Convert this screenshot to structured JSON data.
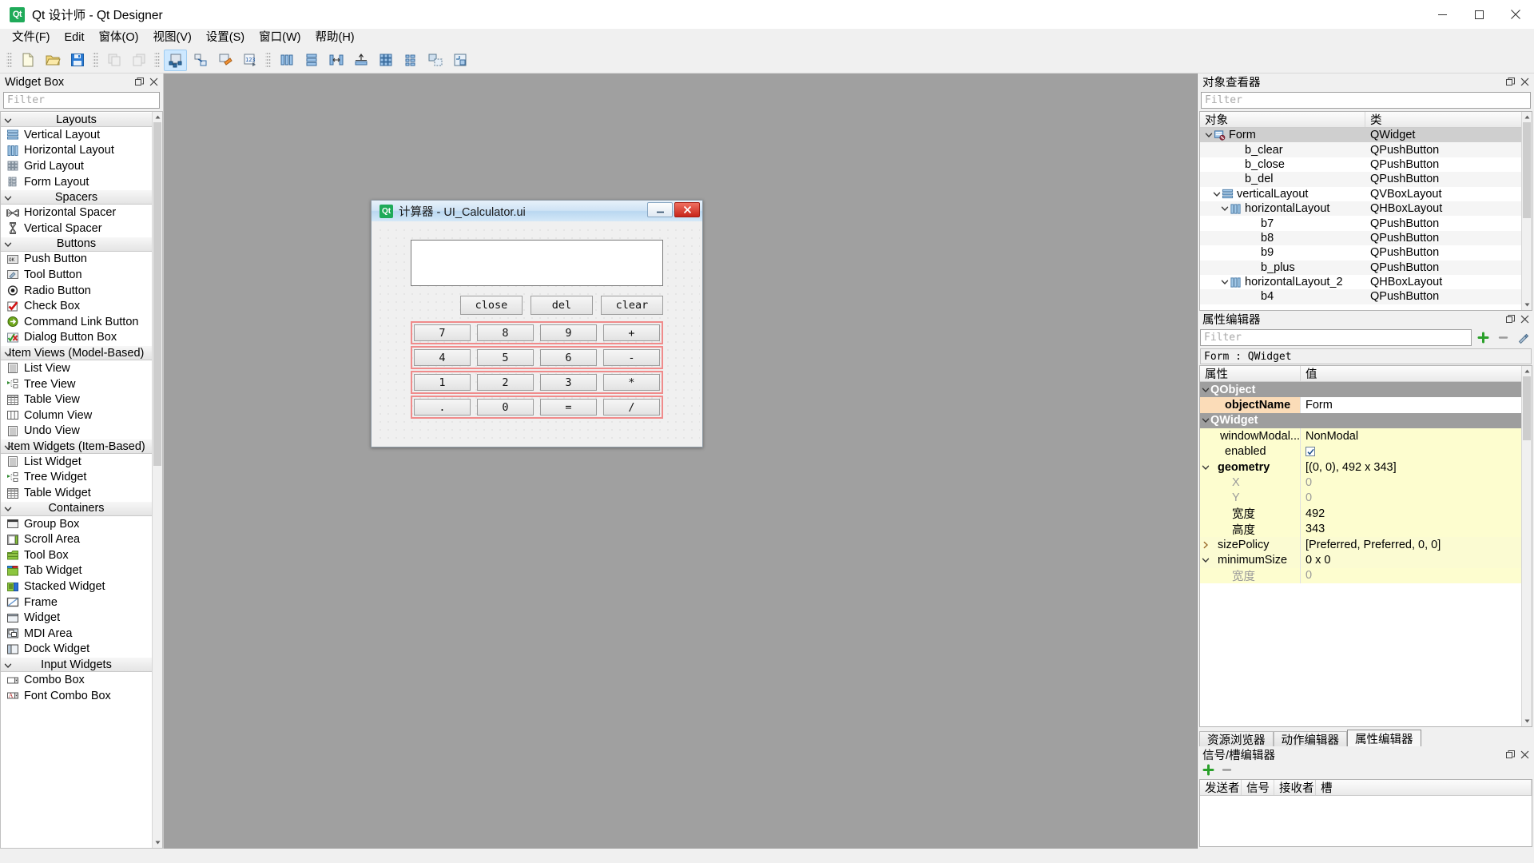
{
  "window": {
    "title": "Qt 设计师 - Qt Designer",
    "icon": "Qt",
    "minimize": "minimize-icon",
    "maximize": "maximize-icon",
    "close": "close-icon"
  },
  "menubar": {
    "items": [
      {
        "label": "文件(F)"
      },
      {
        "label": "Edit"
      },
      {
        "label": "窗体(O)"
      },
      {
        "label": "视图(V)"
      },
      {
        "label": "设置(S)"
      },
      {
        "label": "窗口(W)"
      },
      {
        "label": "帮助(H)"
      }
    ]
  },
  "toolbar": {
    "groups": [
      {
        "buttons": [
          {
            "name": "new-form-icon",
            "state": "enabled"
          },
          {
            "name": "open-form-icon",
            "state": "enabled"
          },
          {
            "name": "save-form-icon",
            "state": "enabled"
          }
        ]
      },
      {
        "buttons": [
          {
            "name": "undo-icon",
            "state": "disabled"
          },
          {
            "name": "redo-icon",
            "state": "disabled"
          }
        ]
      },
      {
        "buttons": [
          {
            "name": "edit-widgets-icon",
            "state": "active"
          },
          {
            "name": "edit-signals-slots-icon",
            "state": "enabled"
          },
          {
            "name": "edit-buddies-icon",
            "state": "enabled"
          },
          {
            "name": "edit-tab-order-icon",
            "state": "enabled"
          }
        ]
      },
      {
        "buttons": [
          {
            "name": "layout-horizontally-icon",
            "state": "enabled"
          },
          {
            "name": "layout-vertically-icon",
            "state": "enabled"
          },
          {
            "name": "layout-splitter-horizontal-icon",
            "state": "enabled"
          },
          {
            "name": "layout-splitter-vertical-icon",
            "state": "enabled"
          },
          {
            "name": "layout-grid-icon",
            "state": "enabled"
          },
          {
            "name": "layout-form-icon",
            "state": "enabled"
          },
          {
            "name": "break-layout-icon",
            "state": "enabled"
          },
          {
            "name": "adjust-size-icon",
            "state": "enabled"
          }
        ]
      }
    ]
  },
  "widget_box": {
    "title": "Widget Box",
    "float_icon": "float-icon",
    "close_icon": "close-icon",
    "filter_placeholder": "Filter",
    "groups": [
      {
        "label": "Layouts",
        "items": [
          {
            "label": "Vertical Layout",
            "icon": "vertical-layout-icon"
          },
          {
            "label": "Horizontal Layout",
            "icon": "horizontal-layout-icon"
          },
          {
            "label": "Grid Layout",
            "icon": "grid-layout-icon"
          },
          {
            "label": "Form Layout",
            "icon": "form-layout-icon"
          }
        ]
      },
      {
        "label": "Spacers",
        "items": [
          {
            "label": "Horizontal Spacer",
            "icon": "horizontal-spacer-icon"
          },
          {
            "label": "Vertical Spacer",
            "icon": "vertical-spacer-icon"
          }
        ]
      },
      {
        "label": "Buttons",
        "items": [
          {
            "label": "Push Button",
            "icon": "push-button-icon"
          },
          {
            "label": "Tool Button",
            "icon": "tool-button-icon"
          },
          {
            "label": "Radio Button",
            "icon": "radio-button-icon"
          },
          {
            "label": "Check Box",
            "icon": "check-box-icon"
          },
          {
            "label": "Command Link Button",
            "icon": "command-link-icon"
          },
          {
            "label": "Dialog Button Box",
            "icon": "dialog-button-box-icon"
          }
        ]
      },
      {
        "label": "Item Views (Model-Based)",
        "items": [
          {
            "label": "List View",
            "icon": "list-view-icon"
          },
          {
            "label": "Tree View",
            "icon": "tree-view-icon"
          },
          {
            "label": "Table View",
            "icon": "table-view-icon"
          },
          {
            "label": "Column View",
            "icon": "column-view-icon"
          },
          {
            "label": "Undo View",
            "icon": "undo-view-icon"
          }
        ]
      },
      {
        "label": "Item Widgets (Item-Based)",
        "items": [
          {
            "label": "List Widget",
            "icon": "list-widget-icon"
          },
          {
            "label": "Tree Widget",
            "icon": "tree-widget-icon"
          },
          {
            "label": "Table Widget",
            "icon": "table-widget-icon"
          }
        ]
      },
      {
        "label": "Containers",
        "items": [
          {
            "label": "Group Box",
            "icon": "group-box-icon"
          },
          {
            "label": "Scroll Area",
            "icon": "scroll-area-icon"
          },
          {
            "label": "Tool Box",
            "icon": "tool-box-icon"
          },
          {
            "label": "Tab Widget",
            "icon": "tab-widget-icon"
          },
          {
            "label": "Stacked Widget",
            "icon": "stacked-widget-icon"
          },
          {
            "label": "Frame",
            "icon": "frame-icon"
          },
          {
            "label": "Widget",
            "icon": "widget-icon"
          },
          {
            "label": "MDI Area",
            "icon": "mdi-area-icon"
          },
          {
            "label": "Dock Widget",
            "icon": "dock-widget-icon"
          }
        ]
      },
      {
        "label": "Input Widgets",
        "items": [
          {
            "label": "Combo Box",
            "icon": "combo-box-icon"
          },
          {
            "label": "Font Combo Box",
            "icon": "font-combo-box-icon"
          }
        ]
      }
    ]
  },
  "form": {
    "title": "计算器 - UI_Calculator.ui",
    "icon": "Qt",
    "minimize": "minimize-icon",
    "close": "close-icon",
    "display_value": "",
    "top_buttons": [
      {
        "label": "close",
        "name": "b_close"
      },
      {
        "label": "del",
        "name": "b_del"
      },
      {
        "label": "clear",
        "name": "b_clear"
      }
    ],
    "keypad": [
      [
        "7",
        "8",
        "9",
        "+"
      ],
      [
        "4",
        "5",
        "6",
        "-"
      ],
      [
        "1",
        "2",
        "3",
        "*"
      ],
      [
        ".",
        "0",
        "=",
        "/"
      ]
    ]
  },
  "object_inspector": {
    "title": "对象查看器",
    "float_icon": "float-icon",
    "close_icon": "close-icon",
    "filter_placeholder": "Filter",
    "columns": {
      "name": "对象",
      "class": "类"
    },
    "rows": [
      {
        "name": "Form",
        "class": "QWidget",
        "depth": 0,
        "expander": "down",
        "icon": "form-icon",
        "selected": true
      },
      {
        "name": "b_clear",
        "class": "QPushButton",
        "depth": 2,
        "expander": "",
        "icon": ""
      },
      {
        "name": "b_close",
        "class": "QPushButton",
        "depth": 2,
        "expander": "",
        "icon": ""
      },
      {
        "name": "b_del",
        "class": "QPushButton",
        "depth": 2,
        "expander": "",
        "icon": ""
      },
      {
        "name": "verticalLayout",
        "class": "QVBoxLayout",
        "depth": 1,
        "expander": "down",
        "icon": "vertical-layout-icon"
      },
      {
        "name": "horizontalLayout",
        "class": "QHBoxLayout",
        "depth": 2,
        "expander": "down",
        "icon": "horizontal-layout-icon"
      },
      {
        "name": "b7",
        "class": "QPushButton",
        "depth": 4,
        "expander": "",
        "icon": ""
      },
      {
        "name": "b8",
        "class": "QPushButton",
        "depth": 4,
        "expander": "",
        "icon": ""
      },
      {
        "name": "b9",
        "class": "QPushButton",
        "depth": 4,
        "expander": "",
        "icon": ""
      },
      {
        "name": "b_plus",
        "class": "QPushButton",
        "depth": 4,
        "expander": "",
        "icon": ""
      },
      {
        "name": "horizontalLayout_2",
        "class": "QHBoxLayout",
        "depth": 2,
        "expander": "down",
        "icon": "horizontal-layout-icon"
      },
      {
        "name": "b4",
        "class": "QPushButton",
        "depth": 4,
        "expander": "",
        "icon": ""
      }
    ]
  },
  "property_editor": {
    "title": "属性编辑器",
    "float_icon": "float-icon",
    "close_icon": "close-icon",
    "filter_placeholder": "Filter",
    "add_icon": "add-icon",
    "remove_icon": "remove-icon",
    "configure_icon": "configure-icon",
    "object_label": "Form : QWidget",
    "columns": {
      "property": "属性",
      "value": "值"
    },
    "rows": [
      {
        "kind": "group",
        "name": "QObject",
        "value": "",
        "expander": "down"
      },
      {
        "kind": "hl",
        "name": "objectName",
        "value": "Form",
        "expander": "",
        "indent": 2
      },
      {
        "kind": "group",
        "name": "QWidget",
        "value": "",
        "expander": "down"
      },
      {
        "kind": "y",
        "name": "windowModal...",
        "value": "NonModal",
        "expander": "",
        "indent": 2
      },
      {
        "kind": "y",
        "name": "enabled",
        "value": "checkbox-checked",
        "expander": "",
        "indent": 2,
        "value_type": "checkbox"
      },
      {
        "kind": "y-bold",
        "name": "geometry",
        "value": "[(0, 0), 492 x 343]",
        "expander": "down",
        "indent": 1
      },
      {
        "kind": "y-grey",
        "name": "X",
        "value": "0",
        "expander": "",
        "indent": 3
      },
      {
        "kind": "y-grey",
        "name": "Y",
        "value": "0",
        "expander": "",
        "indent": 3
      },
      {
        "kind": "y",
        "name": "宽度",
        "value": "492",
        "expander": "",
        "indent": 3
      },
      {
        "kind": "y",
        "name": "高度",
        "value": "343",
        "expander": "",
        "indent": 3
      },
      {
        "kind": "plain",
        "name": "sizePolicy",
        "value": "[Preferred, Preferred, 0, 0]",
        "expander": "right",
        "indent": 1
      },
      {
        "kind": "plain",
        "name": "minimumSize",
        "value": "0 x 0",
        "expander": "down",
        "indent": 1
      },
      {
        "kind": "y-grey-nm",
        "name": "宽度",
        "value": "0",
        "expander": "",
        "indent": 3
      }
    ],
    "tabs": [
      {
        "label": "资源浏览器",
        "active": false
      },
      {
        "label": "动作编辑器",
        "active": false
      },
      {
        "label": "属性编辑器",
        "active": true
      }
    ]
  },
  "signal_slot_editor": {
    "title": "信号/槽编辑器",
    "float_icon": "float-icon",
    "close_icon": "close-icon",
    "add_icon": "add-icon",
    "remove_icon": "remove-icon",
    "columns": [
      "发送者",
      "信号",
      "接收者",
      "槽"
    ],
    "rows": []
  },
  "colors": {
    "canvas": "#a0a0a0",
    "chrome": "#f0f0f0",
    "selection": "#cde8ff",
    "layout_marker": "#f08b8b",
    "property_highlight": "#fbdcb8",
    "property_yellow": "#fdfdcf",
    "group_header": "#9e9e9e",
    "qt_green": "#1faa59"
  }
}
